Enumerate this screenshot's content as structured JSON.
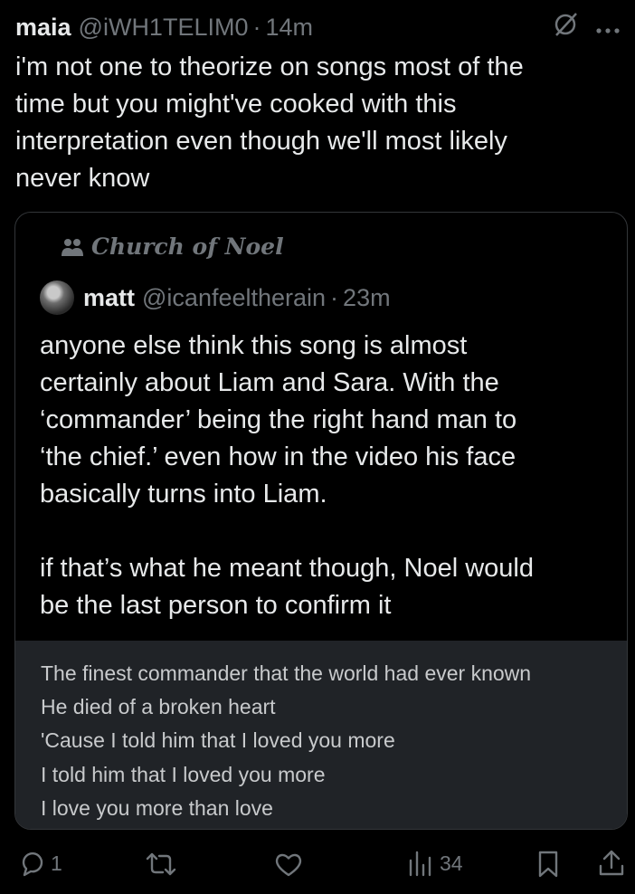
{
  "tweet": {
    "name": "maia",
    "handle": "@iWH1TELIM0",
    "separator": "·",
    "time": "14m",
    "text": "i'm not one to theorize on songs most of the\ntime but you might've cooked with this\ninterpretation even though we'll most likely\nnever know"
  },
  "header_icons": [
    "grok-icon",
    "more-icon"
  ],
  "quote": {
    "community": "Church of Noel",
    "name": "matt",
    "handle": "@icanfeeltherain",
    "separator": "·",
    "time": "23m",
    "text": "anyone else think this song is almost\ncertainly about Liam and Sara. With the\n‘commander’ being the right hand man to\n‘the chief.’ even how in the video his face\nbasically turns into Liam.\n\nif that’s what he meant though, Noel would\nbe the last person to confirm it",
    "lyrics": [
      "The finest commander that the world had ever known",
      "He died of a broken heart",
      "'Cause I told him that I loved you more",
      "I told him that I loved you more",
      "I love you more than love"
    ]
  },
  "actions": {
    "replies": "1",
    "reposts": "",
    "likes": "",
    "views": "34"
  },
  "colors": {
    "background": "#000000",
    "text": "#e7e9ea",
    "secondary": "#71767b",
    "lyrics_bg": "#202327"
  }
}
